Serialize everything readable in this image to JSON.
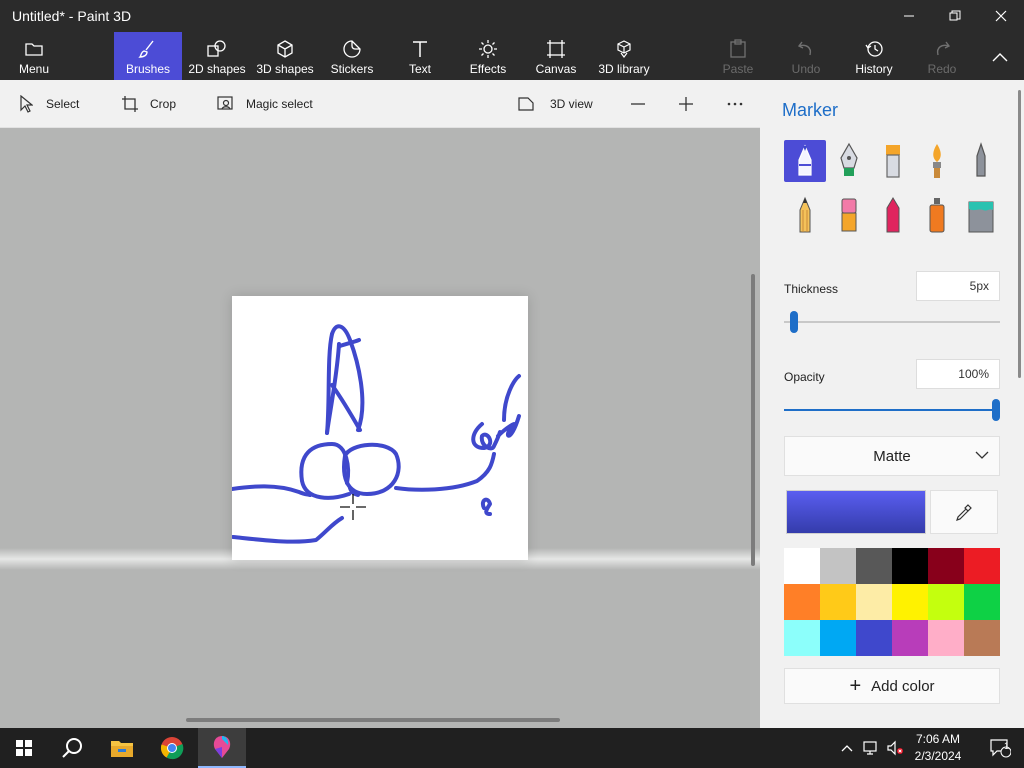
{
  "window": {
    "title": "Untitled* - Paint 3D"
  },
  "ribbon": {
    "menu": "Menu",
    "items": [
      {
        "label": "Brushes",
        "icon": "brush-icon",
        "active": true
      },
      {
        "label": "2D shapes",
        "icon": "shapes-2d-icon"
      },
      {
        "label": "3D shapes",
        "icon": "cube-icon"
      },
      {
        "label": "Stickers",
        "icon": "sticker-icon"
      },
      {
        "label": "Text",
        "icon": "text-icon"
      },
      {
        "label": "Effects",
        "icon": "sun-icon"
      },
      {
        "label": "Canvas",
        "icon": "canvas-icon"
      },
      {
        "label": "3D library",
        "icon": "library-icon"
      }
    ],
    "paste": "Paste",
    "undo": "Undo",
    "history": "History",
    "redo": "Redo"
  },
  "toolbar": {
    "select": "Select",
    "crop": "Crop",
    "magic_select": "Magic select",
    "view_3d": "3D view"
  },
  "panel": {
    "title": "Marker",
    "brushes": [
      "marker-icon",
      "calligraphy-pen-icon",
      "oil-brush-icon",
      "watercolor-icon",
      "pixel-pen-icon",
      "pencil-icon",
      "eraser-icon",
      "crayon-icon",
      "spray-can-icon",
      "fill-bucket-icon"
    ],
    "thickness_label": "Thickness",
    "thickness_value": "5px",
    "thickness_level": 0.03,
    "opacity_label": "Opacity",
    "opacity_value": "100%",
    "opacity_level": 1.0,
    "finish": "Matte",
    "add_color": "Add color",
    "palette": [
      "#ffffff",
      "#c3c3c3",
      "#585858",
      "#000000",
      "#88001b",
      "#ec1c24",
      "#ff7f27",
      "#ffca18",
      "#fdeca6",
      "#fff200",
      "#c4ff0e",
      "#0ed145",
      "#8cfffb",
      "#00a8f3",
      "#3f48cc",
      "#b83dba",
      "#ffaec8",
      "#b97a56"
    ],
    "current_color": "#4a50d8"
  },
  "taskbar": {
    "time": "7:06 AM",
    "date": "2/3/2024",
    "notification_count": "1"
  }
}
